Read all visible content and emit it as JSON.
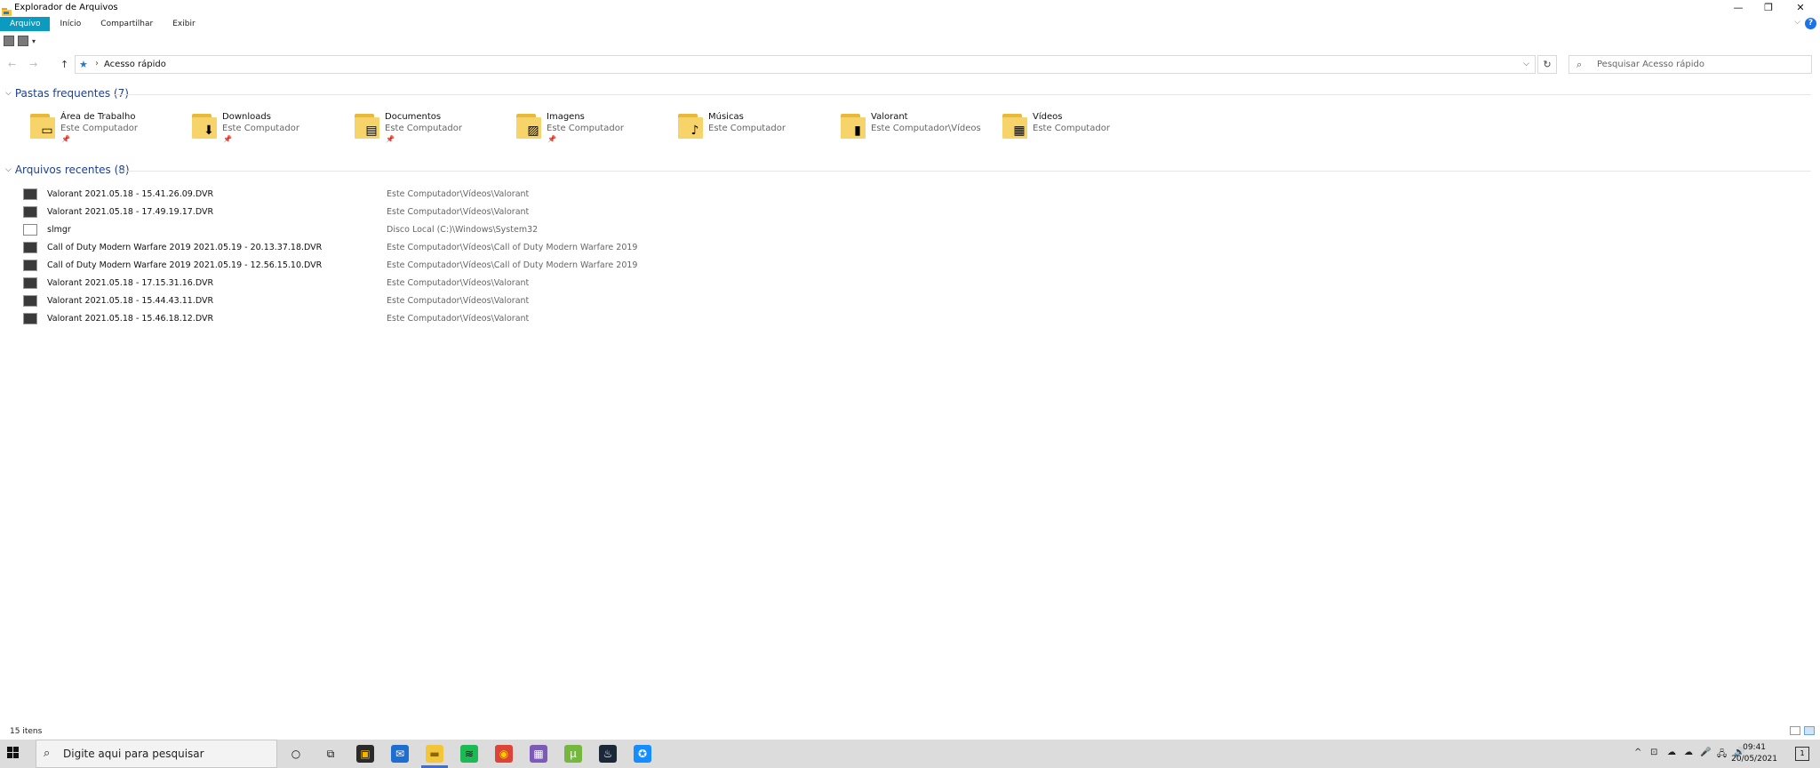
{
  "window": {
    "title": "Explorador de Arquivos",
    "controls": {
      "minimize": "—",
      "restore": "❐",
      "close": "✕"
    }
  },
  "ribbon": {
    "tabs": [
      {
        "label": "Arquivo",
        "active": true
      },
      {
        "label": "Início",
        "active": false
      },
      {
        "label": "Compartilhar",
        "active": false
      },
      {
        "label": "Exibir",
        "active": false
      }
    ],
    "help": "?",
    "expand": "⌵",
    "qat_dropdown": "▾"
  },
  "nav": {
    "back": "←",
    "forward": "→",
    "up": "↑"
  },
  "address": {
    "sep": "›",
    "location": "Acesso rápido",
    "dropdown": "⌵",
    "refresh": "↻"
  },
  "search": {
    "placeholder": "Pesquisar Acesso rápido"
  },
  "frequent": {
    "header": "Pastas frequentes (7)",
    "folders": [
      {
        "name": "Área de Trabalho",
        "location": "Este Computador",
        "pinned": true,
        "pin": "📌",
        "icon": "desktop-icon",
        "badge": "▭"
      },
      {
        "name": "Downloads",
        "location": "Este Computador",
        "pinned": true,
        "pin": "📌",
        "icon": "download-icon",
        "badge": "⬇"
      },
      {
        "name": "Documentos",
        "location": "Este Computador",
        "pinned": true,
        "pin": "📌",
        "icon": "document-icon",
        "badge": "▤"
      },
      {
        "name": "Imagens",
        "location": "Este Computador",
        "pinned": true,
        "pin": "📌",
        "icon": "picture-icon",
        "badge": "▨"
      },
      {
        "name": "Músicas",
        "location": "Este Computador",
        "pinned": false,
        "pin": "",
        "icon": "music-icon",
        "badge": "♪"
      },
      {
        "name": "Valorant",
        "location": "Este Computador\\Vídeos",
        "pinned": false,
        "pin": "",
        "icon": "valorant-folder-icon",
        "badge": "▮"
      },
      {
        "name": "Vídeos",
        "location": "Este Computador",
        "pinned": false,
        "pin": "",
        "icon": "video-icon",
        "badge": "▦"
      }
    ]
  },
  "recent": {
    "header": "Arquivos recentes (8)",
    "files": [
      {
        "name": "Valorant 2021.05.18 - 15.41.26.09.DVR",
        "path": "Este Computador\\Vídeos\\Valorant",
        "type": "video"
      },
      {
        "name": "Valorant 2021.05.18 - 17.49.19.17.DVR",
        "path": "Este Computador\\Vídeos\\Valorant",
        "type": "video"
      },
      {
        "name": "slmgr",
        "path": "Disco Local (C:)\\Windows\\System32",
        "type": "script"
      },
      {
        "name": "Call of Duty  Modern Warfare 2019 2021.05.19 - 20.13.37.18.DVR",
        "path": "Este Computador\\Vídeos\\Call of Duty  Modern Warfare 2019",
        "type": "video"
      },
      {
        "name": "Call of Duty  Modern Warfare 2019 2021.05.19 - 12.56.15.10.DVR",
        "path": "Este Computador\\Vídeos\\Call of Duty  Modern Warfare 2019",
        "type": "video"
      },
      {
        "name": "Valorant 2021.05.18 - 17.15.31.16.DVR",
        "path": "Este Computador\\Vídeos\\Valorant",
        "type": "video"
      },
      {
        "name": "Valorant 2021.05.18 - 15.44.43.11.DVR",
        "path": "Este Computador\\Vídeos\\Valorant",
        "type": "video"
      },
      {
        "name": "Valorant 2021.05.18 - 15.46.18.12.DVR",
        "path": "Este Computador\\Vídeos\\Valorant",
        "type": "video"
      }
    ]
  },
  "status": {
    "item_count": "15 itens"
  },
  "taskbar": {
    "search_placeholder": "Digite aqui para pesquisar",
    "apps": [
      {
        "name": "cortana-icon",
        "glyph": "○",
        "color": "#dcdcdc",
        "fg": "#111"
      },
      {
        "name": "task-view-icon",
        "glyph": "⧉",
        "color": "#dcdcdc",
        "fg": "#111"
      },
      {
        "name": "store-icon",
        "glyph": "▣",
        "color": "#2b2b2b",
        "fg": "#f2b600"
      },
      {
        "name": "mail-icon",
        "glyph": "✉",
        "color": "#1c6fd0",
        "fg": "#fff"
      },
      {
        "name": "file-explorer-icon",
        "glyph": "▬",
        "color": "#f3c53a",
        "fg": "#8a6a00",
        "active": true
      },
      {
        "name": "spotify-icon",
        "glyph": "≋",
        "color": "#1db954",
        "fg": "#111"
      },
      {
        "name": "chrome-icon",
        "glyph": "◉",
        "color": "#db4437",
        "fg": "#ffcc00"
      },
      {
        "name": "photo-app-icon",
        "glyph": "▦",
        "color": "#7d5ab8",
        "fg": "#fff"
      },
      {
        "name": "utorrent-icon",
        "glyph": "µ",
        "color": "#76b83f",
        "fg": "#fff"
      },
      {
        "name": "steam-icon",
        "glyph": "♨",
        "color": "#1b2838",
        "fg": "#fff"
      },
      {
        "name": "battlenet-icon",
        "glyph": "✪",
        "color": "#148eff",
        "fg": "#fff"
      }
    ],
    "tray": {
      "chevron": "^",
      "icons": [
        "⊡",
        "☁",
        "☁",
        "🎤",
        "🖧",
        "🔊"
      ],
      "time": "09:41",
      "date": "20/05/2021",
      "notifications": "1"
    }
  }
}
